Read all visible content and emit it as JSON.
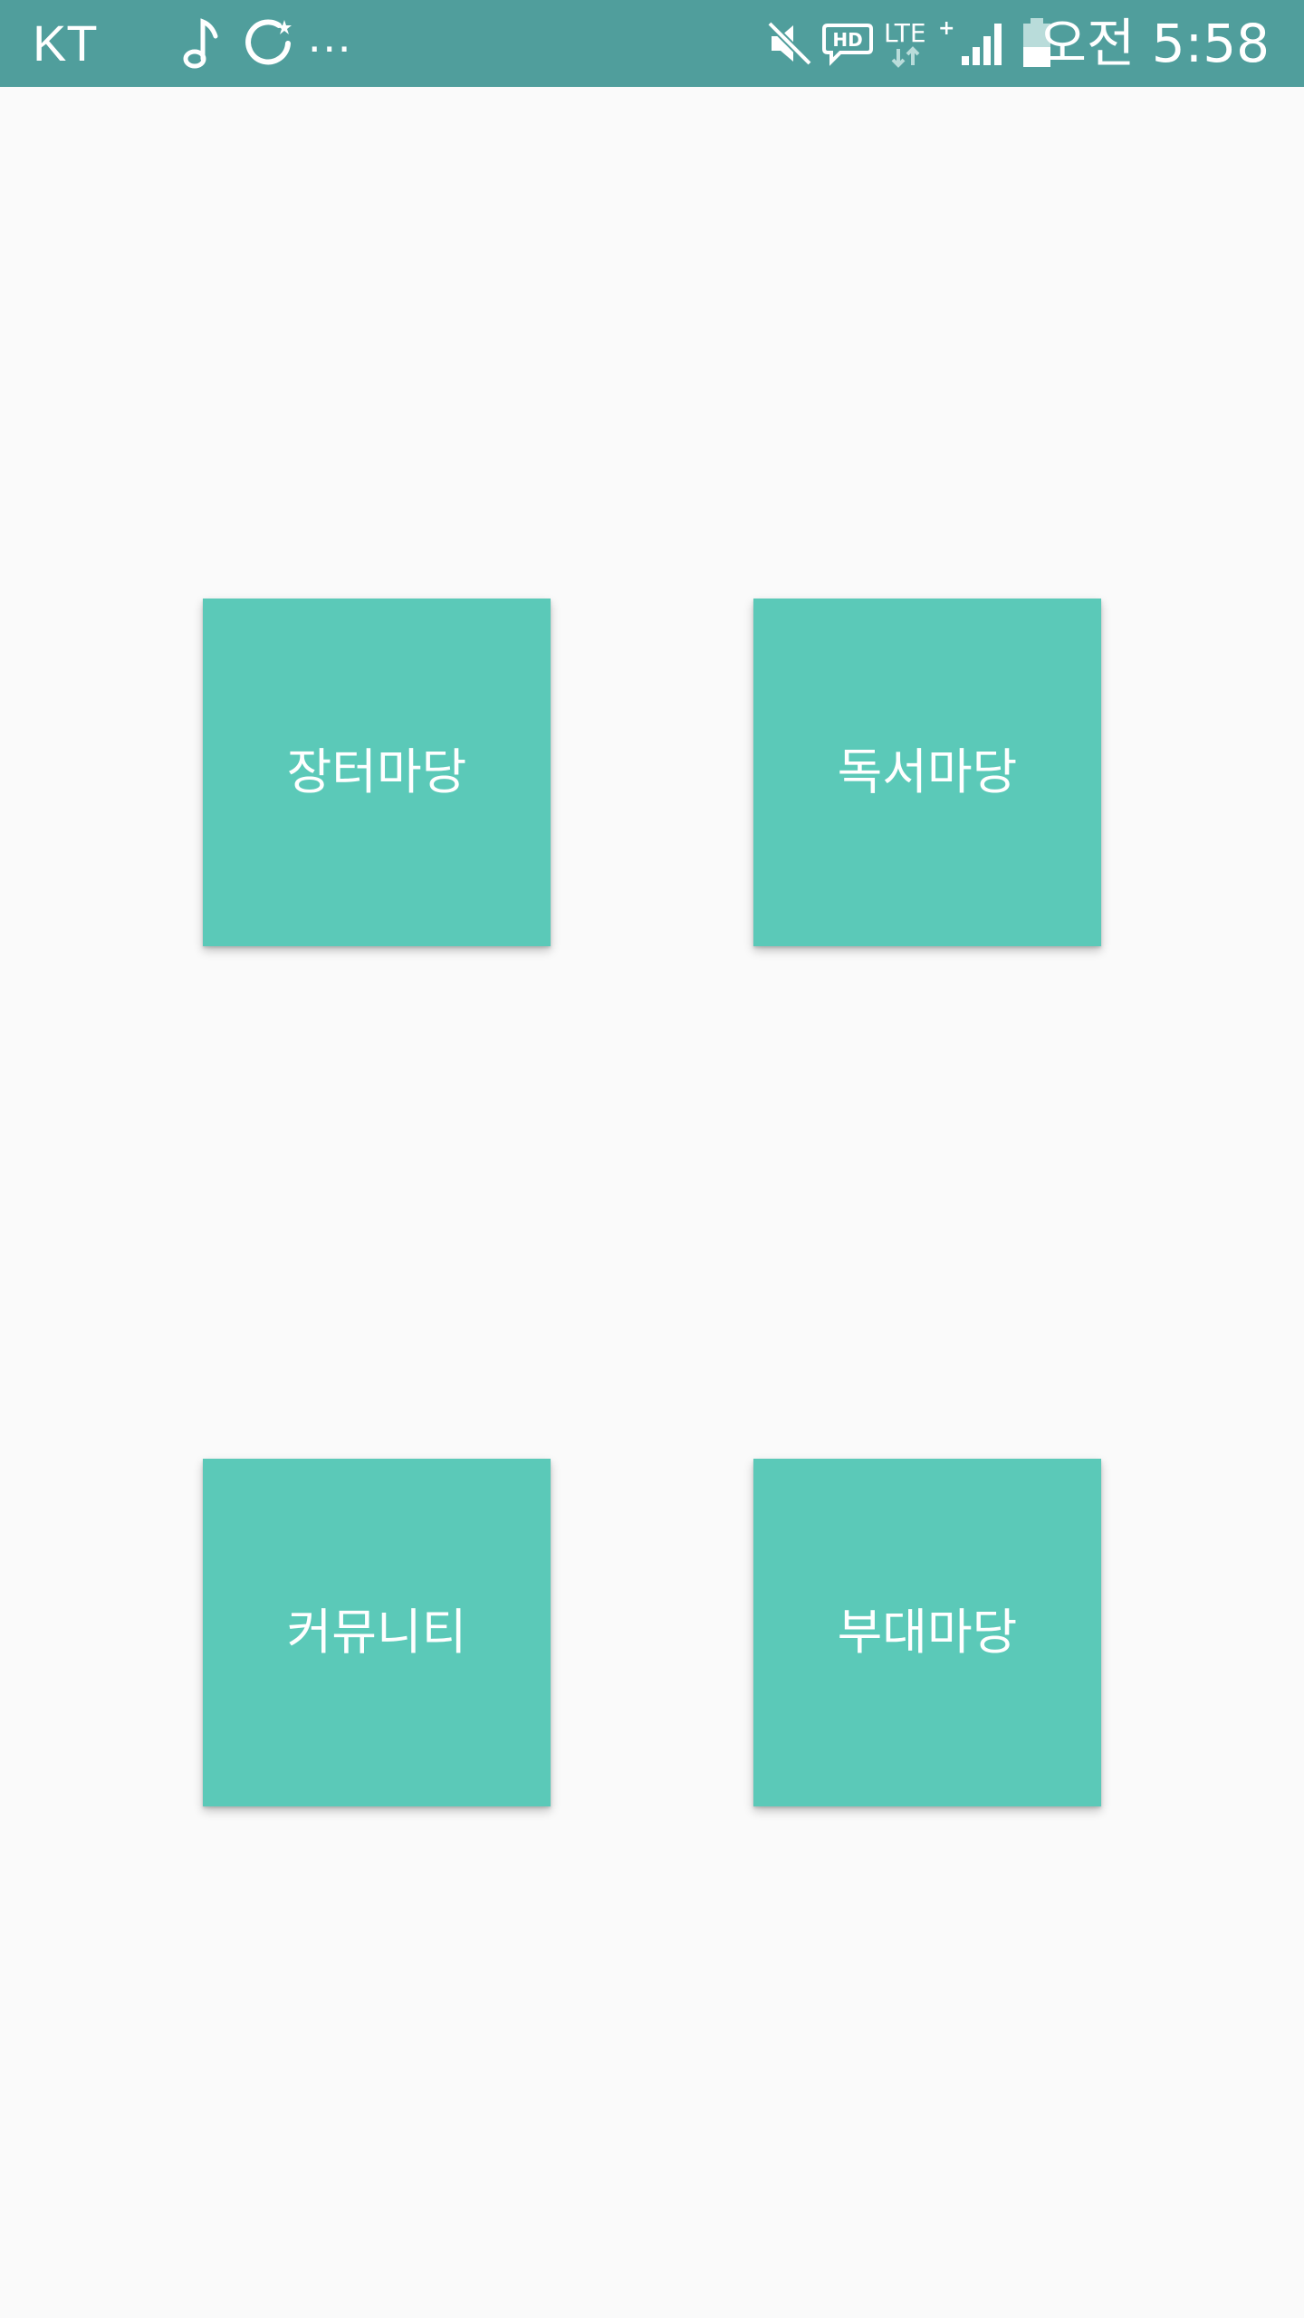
{
  "status_bar": {
    "carrier": "KT",
    "overflow": "...",
    "network": "LTE",
    "time": "오전 5:58",
    "icons": [
      "music-note-icon",
      "sync-icon",
      "mute-icon",
      "hd-voice-icon",
      "lte-plus-icon",
      "signal-icon",
      "battery-icon"
    ],
    "color": "#509e9c",
    "battery_level": 0.45
  },
  "menu": {
    "tiles": [
      {
        "label": "장터마당"
      },
      {
        "label": "독서마당"
      },
      {
        "label": "커뮤니티"
      },
      {
        "label": "부대마당"
      }
    ],
    "tile_color": "#5bc9b8"
  },
  "background": "#fafafa"
}
